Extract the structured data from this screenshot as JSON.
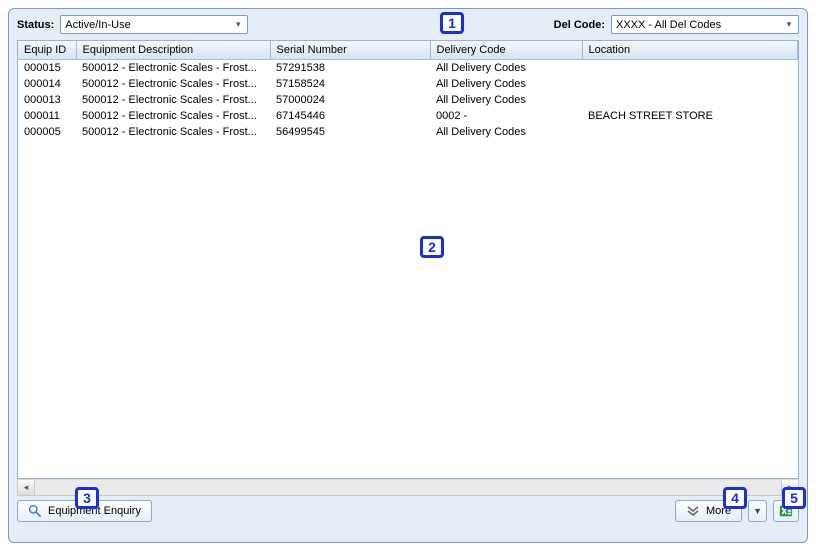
{
  "filters": {
    "status_label": "Status:",
    "status_value": "Active/In-Use",
    "delcode_label": "Del Code:",
    "delcode_value": "XXXX - All Del Codes"
  },
  "columns": {
    "equip_id": "Equip ID",
    "equip_desc": "Equipment Description",
    "serial": "Serial Number",
    "delivery_code": "Delivery Code",
    "location": "Location"
  },
  "rows": [
    {
      "id": "000015",
      "desc": "500012 - Electronic Scales - Frost...",
      "sn": "57291538",
      "dc": "All Delivery Codes",
      "loc": ""
    },
    {
      "id": "000014",
      "desc": "500012 - Electronic Scales - Frost...",
      "sn": "57158524",
      "dc": "All Delivery Codes",
      "loc": ""
    },
    {
      "id": "000013",
      "desc": "500012 - Electronic Scales - Frost...",
      "sn": "57000024",
      "dc": "All Delivery Codes",
      "loc": ""
    },
    {
      "id": "000011",
      "desc": "500012 - Electronic Scales - Frost...",
      "sn": "67145446",
      "dc": "0002 -",
      "loc": "BEACH STREET STORE"
    },
    {
      "id": "000005",
      "desc": "500012 - Electronic Scales - Frost...",
      "sn": "56499545",
      "dc": "All Delivery Codes",
      "loc": ""
    }
  ],
  "buttons": {
    "equipment_enquiry": "Equipment Enquiry",
    "more": "More"
  },
  "markers": {
    "m1": "1",
    "m2": "2",
    "m3": "3",
    "m4": "4",
    "m5": "5"
  }
}
